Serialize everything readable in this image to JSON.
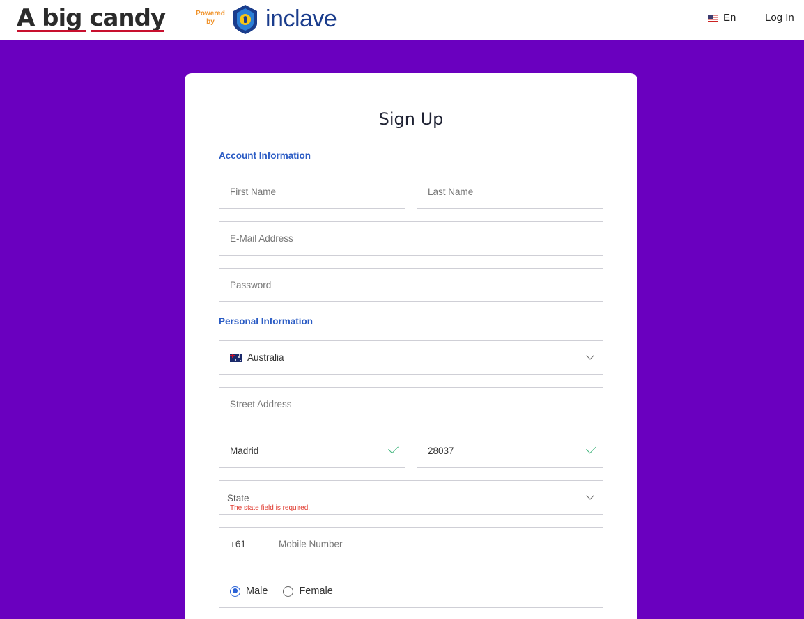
{
  "header": {
    "brand_text": "A big candy",
    "powered_by": "Powered by",
    "partner_name": "inclave",
    "language": "En",
    "login_label": "Log In",
    "colors": {
      "accent_purple": "#6a00bf",
      "brand_red": "#c8102e",
      "partner_blue": "#1a3c8c"
    }
  },
  "form": {
    "title": "Sign Up",
    "account_section": "Account Information",
    "personal_section": "Personal Information",
    "first_name_placeholder": "First Name",
    "last_name_placeholder": "Last Name",
    "email_placeholder": "E-Mail Address",
    "password_placeholder": "Password",
    "country_value": "Australia",
    "street_placeholder": "Street Address",
    "city_value": "Madrid",
    "zip_value": "28037",
    "state_label": "State",
    "state_error": "The state field is required.",
    "phone_prefix": "+61",
    "mobile_placeholder": "Mobile Number",
    "gender_options": [
      {
        "label": "Male",
        "selected": true
      },
      {
        "label": "Female",
        "selected": false
      }
    ]
  }
}
